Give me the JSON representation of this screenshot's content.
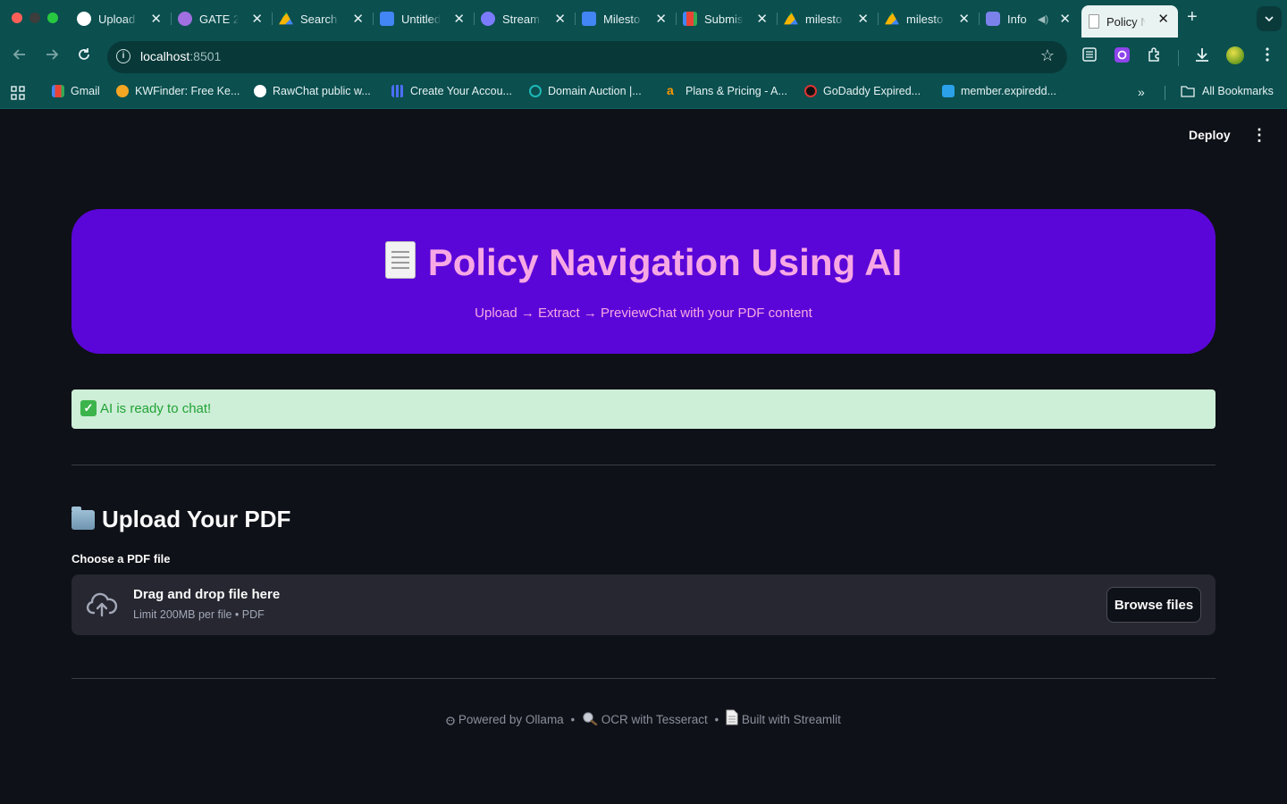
{
  "browser": {
    "tabs": [
      {
        "label": "Upload",
        "icon": "github-icon",
        "color": "#ffffff"
      },
      {
        "label": "GATE 2(",
        "icon": "gate-icon",
        "color": "#a06fe0"
      },
      {
        "label": "Search",
        "icon": "google-drive-icon",
        "color": "#f4b400"
      },
      {
        "label": "Untitled",
        "icon": "google-docs-icon",
        "color": "#4285f4"
      },
      {
        "label": "Stream",
        "icon": "streamlit-icon",
        "color": "#7b7bff"
      },
      {
        "label": "Milesto",
        "icon": "google-docs-icon",
        "color": "#4285f4"
      },
      {
        "label": "Submis",
        "icon": "gmail-icon",
        "color": "#ea4335"
      },
      {
        "label": "milesto",
        "icon": "google-drive-icon",
        "color": "#0f9d58"
      },
      {
        "label": "milesto",
        "icon": "google-drive-icon",
        "color": "#0f9d58"
      },
      {
        "label": "Info",
        "icon": "teams-icon",
        "color": "#7b83eb"
      },
      {
        "label": "Policy N",
        "icon": "document-icon",
        "color": "#d9d9d9",
        "active": true
      }
    ],
    "address": {
      "host": "localhost",
      "port": ":8501"
    },
    "bookmarks": [
      {
        "label": "Gmail",
        "icon": "gmail-icon",
        "color": "#ea4335"
      },
      {
        "label": "KWFinder: Free Ke...",
        "icon": "kwfinder-icon",
        "color": "#f5a623"
      },
      {
        "label": "RawChat public w...",
        "icon": "rawchat-icon",
        "color": "#ffffff"
      },
      {
        "label": "Create Your Accou...",
        "icon": "grid-app-icon",
        "color": "#4c6ef5"
      },
      {
        "label": "Domain Auction |...",
        "icon": "domain-auction-icon",
        "color": "#1fb7b7"
      },
      {
        "label": "Plans & Pricing - A...",
        "icon": "amazon-icon",
        "color": "#ff9900"
      },
      {
        "label": "GoDaddy Expired...",
        "icon": "godaddy-icon",
        "color": "#111111"
      },
      {
        "label": "member.expiredd...",
        "icon": "expireddomains-icon",
        "color": "#2aa1e8"
      }
    ],
    "all_bookmarks_label": "All Bookmarks"
  },
  "app": {
    "deploy_label": "Deploy",
    "hero": {
      "title": "Policy Navigation Using AI",
      "subtitle": "Upload → Extract → PreviewChat with your PDF content",
      "bg_color": "#5b06d8",
      "text_color": "#f7a8e4"
    },
    "status": {
      "text": "AI is ready to chat!",
      "type": "success"
    },
    "upload": {
      "section_title": "Upload Your PDF",
      "field_label": "Choose a PDF file",
      "drop_main": "Drag and drop file here",
      "drop_sub": "Limit 200MB per file • PDF",
      "browse_label": "Browse files"
    },
    "footer": {
      "part1": "Powered by Ollama",
      "part2": "OCR with Tesseract",
      "part3": "Built with Streamlit",
      "separator": "•"
    }
  }
}
